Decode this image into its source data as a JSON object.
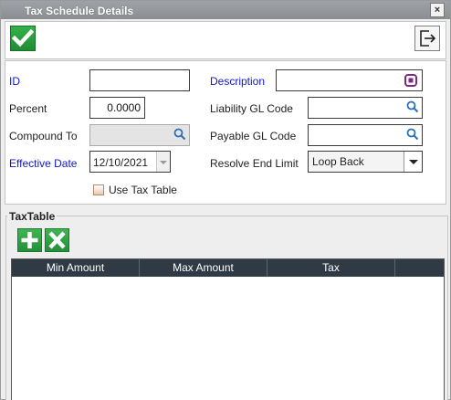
{
  "window": {
    "title": "Tax Schedule Details",
    "close_glyph": "×"
  },
  "toolbar": {
    "save_icon": "checkmark-icon",
    "exit_icon": "exit-icon"
  },
  "form": {
    "id_label": "ID",
    "id_value": "",
    "description_label": "Description",
    "description_value": "",
    "percent_label": "Percent",
    "percent_value": "0.0000",
    "liability_gl_label": "Liability GL Code",
    "liability_gl_value": "",
    "compound_to_label": "Compound To",
    "compound_to_value": "",
    "payable_gl_label": "Payable GL Code",
    "payable_gl_value": "",
    "effective_date_label": "Effective Date",
    "effective_date_value": "12/10/2021",
    "resolve_end_limit_label": "Resolve End Limit",
    "resolve_end_limit_value": "Loop Back",
    "use_tax_table_label": "Use Tax Table",
    "use_tax_table_checked": false
  },
  "tax_table": {
    "legend": "TaxTable",
    "columns": [
      "Min Amount",
      "Max Amount",
      "Tax"
    ],
    "rows": []
  },
  "colors": {
    "required_label": "#1018c8",
    "accent_green": "#2a9a3e",
    "grid_header": "#2f3a44",
    "description_icon": "#7a2a86",
    "lookup_icon": "#2a6fb5"
  }
}
